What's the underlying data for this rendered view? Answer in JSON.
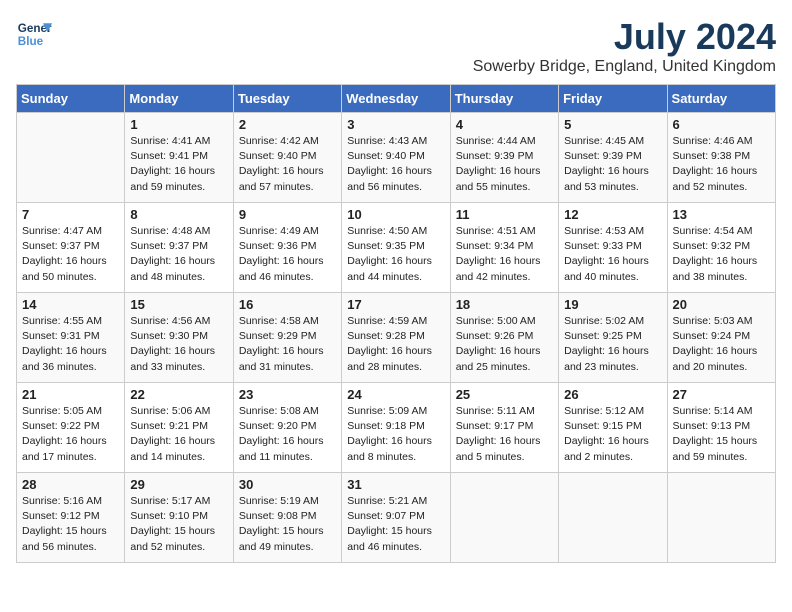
{
  "logo": {
    "line1": "General",
    "line2": "Blue"
  },
  "title": "July 2024",
  "location": "Sowerby Bridge, England, United Kingdom",
  "days_of_week": [
    "Sunday",
    "Monday",
    "Tuesday",
    "Wednesday",
    "Thursday",
    "Friday",
    "Saturday"
  ],
  "weeks": [
    [
      {
        "day": "",
        "info": ""
      },
      {
        "day": "1",
        "info": "Sunrise: 4:41 AM\nSunset: 9:41 PM\nDaylight: 16 hours\nand 59 minutes."
      },
      {
        "day": "2",
        "info": "Sunrise: 4:42 AM\nSunset: 9:40 PM\nDaylight: 16 hours\nand 57 minutes."
      },
      {
        "day": "3",
        "info": "Sunrise: 4:43 AM\nSunset: 9:40 PM\nDaylight: 16 hours\nand 56 minutes."
      },
      {
        "day": "4",
        "info": "Sunrise: 4:44 AM\nSunset: 9:39 PM\nDaylight: 16 hours\nand 55 minutes."
      },
      {
        "day": "5",
        "info": "Sunrise: 4:45 AM\nSunset: 9:39 PM\nDaylight: 16 hours\nand 53 minutes."
      },
      {
        "day": "6",
        "info": "Sunrise: 4:46 AM\nSunset: 9:38 PM\nDaylight: 16 hours\nand 52 minutes."
      }
    ],
    [
      {
        "day": "7",
        "info": "Sunrise: 4:47 AM\nSunset: 9:37 PM\nDaylight: 16 hours\nand 50 minutes."
      },
      {
        "day": "8",
        "info": "Sunrise: 4:48 AM\nSunset: 9:37 PM\nDaylight: 16 hours\nand 48 minutes."
      },
      {
        "day": "9",
        "info": "Sunrise: 4:49 AM\nSunset: 9:36 PM\nDaylight: 16 hours\nand 46 minutes."
      },
      {
        "day": "10",
        "info": "Sunrise: 4:50 AM\nSunset: 9:35 PM\nDaylight: 16 hours\nand 44 minutes."
      },
      {
        "day": "11",
        "info": "Sunrise: 4:51 AM\nSunset: 9:34 PM\nDaylight: 16 hours\nand 42 minutes."
      },
      {
        "day": "12",
        "info": "Sunrise: 4:53 AM\nSunset: 9:33 PM\nDaylight: 16 hours\nand 40 minutes."
      },
      {
        "day": "13",
        "info": "Sunrise: 4:54 AM\nSunset: 9:32 PM\nDaylight: 16 hours\nand 38 minutes."
      }
    ],
    [
      {
        "day": "14",
        "info": "Sunrise: 4:55 AM\nSunset: 9:31 PM\nDaylight: 16 hours\nand 36 minutes."
      },
      {
        "day": "15",
        "info": "Sunrise: 4:56 AM\nSunset: 9:30 PM\nDaylight: 16 hours\nand 33 minutes."
      },
      {
        "day": "16",
        "info": "Sunrise: 4:58 AM\nSunset: 9:29 PM\nDaylight: 16 hours\nand 31 minutes."
      },
      {
        "day": "17",
        "info": "Sunrise: 4:59 AM\nSunset: 9:28 PM\nDaylight: 16 hours\nand 28 minutes."
      },
      {
        "day": "18",
        "info": "Sunrise: 5:00 AM\nSunset: 9:26 PM\nDaylight: 16 hours\nand 25 minutes."
      },
      {
        "day": "19",
        "info": "Sunrise: 5:02 AM\nSunset: 9:25 PM\nDaylight: 16 hours\nand 23 minutes."
      },
      {
        "day": "20",
        "info": "Sunrise: 5:03 AM\nSunset: 9:24 PM\nDaylight: 16 hours\nand 20 minutes."
      }
    ],
    [
      {
        "day": "21",
        "info": "Sunrise: 5:05 AM\nSunset: 9:22 PM\nDaylight: 16 hours\nand 17 minutes."
      },
      {
        "day": "22",
        "info": "Sunrise: 5:06 AM\nSunset: 9:21 PM\nDaylight: 16 hours\nand 14 minutes."
      },
      {
        "day": "23",
        "info": "Sunrise: 5:08 AM\nSunset: 9:20 PM\nDaylight: 16 hours\nand 11 minutes."
      },
      {
        "day": "24",
        "info": "Sunrise: 5:09 AM\nSunset: 9:18 PM\nDaylight: 16 hours\nand 8 minutes."
      },
      {
        "day": "25",
        "info": "Sunrise: 5:11 AM\nSunset: 9:17 PM\nDaylight: 16 hours\nand 5 minutes."
      },
      {
        "day": "26",
        "info": "Sunrise: 5:12 AM\nSunset: 9:15 PM\nDaylight: 16 hours\nand 2 minutes."
      },
      {
        "day": "27",
        "info": "Sunrise: 5:14 AM\nSunset: 9:13 PM\nDaylight: 15 hours\nand 59 minutes."
      }
    ],
    [
      {
        "day": "28",
        "info": "Sunrise: 5:16 AM\nSunset: 9:12 PM\nDaylight: 15 hours\nand 56 minutes."
      },
      {
        "day": "29",
        "info": "Sunrise: 5:17 AM\nSunset: 9:10 PM\nDaylight: 15 hours\nand 52 minutes."
      },
      {
        "day": "30",
        "info": "Sunrise: 5:19 AM\nSunset: 9:08 PM\nDaylight: 15 hours\nand 49 minutes."
      },
      {
        "day": "31",
        "info": "Sunrise: 5:21 AM\nSunset: 9:07 PM\nDaylight: 15 hours\nand 46 minutes."
      },
      {
        "day": "",
        "info": ""
      },
      {
        "day": "",
        "info": ""
      },
      {
        "day": "",
        "info": ""
      }
    ]
  ]
}
